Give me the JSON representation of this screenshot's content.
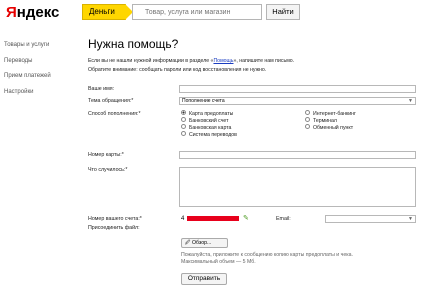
{
  "header": {
    "logo_first": "Я",
    "logo_rest": "ндекс",
    "money_tab": "Деньги",
    "search_placeholder": "Товар, услуга или магазин",
    "find_button": "Найти"
  },
  "sidebar": {
    "items": [
      {
        "label": "Товары и услуги"
      },
      {
        "label": "Переводы"
      },
      {
        "label": "Прием платежей"
      },
      {
        "label": "Настройки"
      }
    ]
  },
  "page": {
    "title": "Нужна помощь?",
    "intro_line1_a": "Если вы не нашли нужной информации в разделе «",
    "intro_link": "Помощь",
    "intro_line1_b": "», напишите нам письмо.",
    "intro_line2": "Обратите внимание: сообщать пароли или код восстановления не нужно."
  },
  "form": {
    "name_label": "Ваше имя:",
    "topic_label": "Тема обращения:*",
    "topic_value": "Пополнение счета",
    "method_label": "Способ пополнения:*",
    "methods_left": [
      {
        "label": "Карта предоплаты",
        "selected": true
      },
      {
        "label": "Банковский счет",
        "selected": false
      },
      {
        "label": "Банковская карта",
        "selected": false
      },
      {
        "label": "Система переводов",
        "selected": false
      }
    ],
    "methods_right": [
      {
        "label": "Интернет-банкинг",
        "selected": false
      },
      {
        "label": "Терминал",
        "selected": false
      },
      {
        "label": "Обменный пункт",
        "selected": false
      }
    ],
    "card_label": "Номер карты:*",
    "what_label": "Что случилось:*",
    "account_label": "Номер вашего счета:*",
    "account_prefix": "4",
    "email_label": "Email:",
    "attach_label": "Присоединить файл:",
    "browse_button": "Обзор...",
    "hint_line1": "Пожалуйста, приложите к сообщению копию карты предоплаты и чека.",
    "hint_line2": "Максимальный объем — 5 Мб.",
    "send_button": "Отправить"
  },
  "colors": {
    "accent_yellow": "#ffd600",
    "logo_red": "#e60000",
    "link_blue": "#1a3dc1"
  }
}
